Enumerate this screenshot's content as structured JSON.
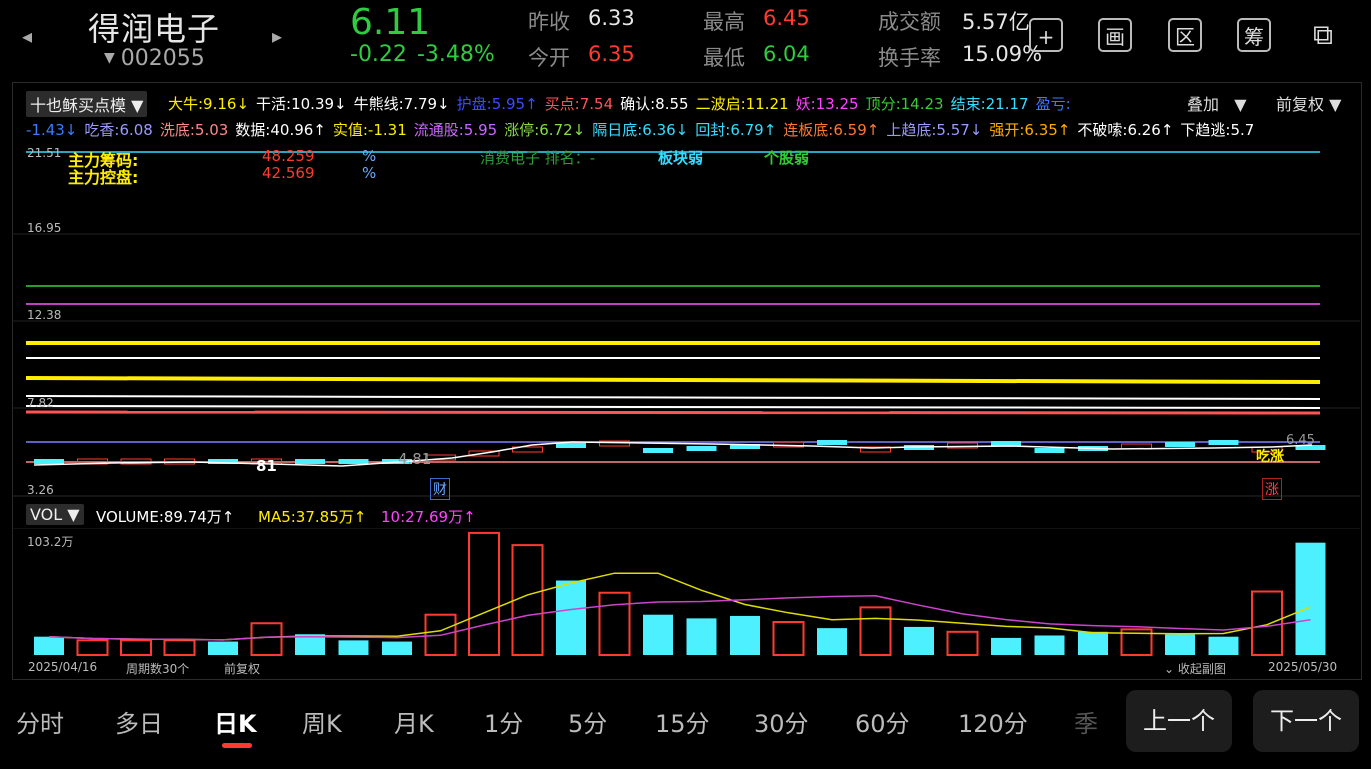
{
  "header": {
    "name": "得润电子",
    "code": "002055",
    "price": "6.11",
    "change": "-0.22",
    "change_pct": "-3.48%",
    "quotes": {
      "prev_close_label": "昨收",
      "prev_close": "6.33",
      "open_label": "今开",
      "open": "6.35",
      "high_label": "最高",
      "high": "6.45",
      "low_label": "最低",
      "low": "6.04",
      "amount_label": "成交额",
      "amount": "5.57亿",
      "turnover_label": "换手率",
      "turnover": "15.09%"
    },
    "toolbar": [
      "+",
      "画",
      "区",
      "筹",
      "⧉"
    ]
  },
  "indicator": {
    "name": "十也稣买点模",
    "overlay": "叠加",
    "adjust": "前复权",
    "row1": [
      {
        "t": "大牛:9.16↓",
        "c": "#ffee00"
      },
      {
        "t": "干活:10.39↓",
        "c": "#ffffff"
      },
      {
        "t": "牛熊线:7.79↓",
        "c": "#ffffff"
      },
      {
        "t": "护盘:5.95↑",
        "c": "#3a4cff"
      },
      {
        "t": "买点:7.54",
        "c": "#ff5555"
      },
      {
        "t": "确认:8.55",
        "c": "#ffffff"
      },
      {
        "t": "二波启:11.21",
        "c": "#ffee00"
      },
      {
        "t": "妖:13.25",
        "c": "#ff44ff"
      },
      {
        "t": "顶分:14.23",
        "c": "#33cc33"
      },
      {
        "t": "结束:21.17",
        "c": "#33ddff"
      },
      {
        "t": "盈亏:",
        "c": "#3a7bff"
      }
    ],
    "row2": [
      {
        "t": "-1.43↓",
        "c": "#3a7bff"
      },
      {
        "t": "吃香:6.08",
        "c": "#9a9aff"
      },
      {
        "t": "洗底:5.03",
        "c": "#ff8888"
      },
      {
        "t": "数据:40.96↑",
        "c": "#ffffff"
      },
      {
        "t": "实值:-1.31",
        "c": "#ffee00"
      },
      {
        "t": "流通股:5.95",
        "c": "#cc66ff"
      },
      {
        "t": "涨停:6.72↓",
        "c": "#88dd44"
      },
      {
        "t": "隔日底:6.36↓",
        "c": "#33ddff"
      },
      {
        "t": "回封:6.79↑",
        "c": "#33ddff"
      },
      {
        "t": "连板底:6.59↑",
        "c": "#ff7733"
      },
      {
        "t": "上趋底:5.57↓",
        "c": "#9a9aff"
      },
      {
        "t": "强开:6.35↑",
        "c": "#ffaa00"
      },
      {
        "t": "不破嗦:6.26↑",
        "c": "#ffffff"
      },
      {
        "t": "下趋逃:5.7",
        "c": "#ffffff"
      }
    ],
    "fund_chips_label": "主力筹码:",
    "fund_chips": "48.259",
    "fund_ctrl_label": "主力控盘:",
    "fund_ctrl": "42.569",
    "pct": "%",
    "sector": "消费电子 排名：-",
    "sector_state": "板块弱",
    "stock_state": "个股弱",
    "marker_81": "81",
    "marker_481": "4.81",
    "tag_cai": "财",
    "tag_zhang": "涨",
    "tag_chizhang": "吃涨",
    "tag_645": "6.45"
  },
  "price_axis": [
    "21.51",
    "16.95",
    "12.38",
    "7.82",
    "3.26"
  ],
  "volume": {
    "label": "VOL",
    "volume": "VOLUME:89.74万↑",
    "ma5": "MA5:37.85万↑",
    "ma10": "10:27.69万↑",
    "max": "103.2万",
    "start_date": "2025/04/16",
    "period": "周期数30个",
    "adjust": "前复权",
    "collapse": "收起副图",
    "end_date": "2025/05/30"
  },
  "chart_data": {
    "type": "bar",
    "title": "",
    "values": [
      15,
      12,
      12,
      12,
      11,
      26,
      17,
      12,
      11,
      33,
      100,
      90,
      61,
      51,
      33,
      30,
      32,
      27,
      22,
      39,
      23,
      19,
      14,
      16,
      19,
      21,
      17,
      15,
      52,
      92
    ],
    "up": [
      false,
      true,
      true,
      true,
      false,
      true,
      false,
      false,
      false,
      true,
      true,
      true,
      false,
      true,
      false,
      false,
      false,
      true,
      false,
      true,
      false,
      true,
      false,
      false,
      false,
      true,
      false,
      false,
      true,
      false
    ],
    "ylim": [
      0,
      103.2
    ]
  },
  "tabs": [
    "分时",
    "多日",
    "日K",
    "周K",
    "月K",
    "1分",
    "5分",
    "15分",
    "30分",
    "60分",
    "120分",
    "季"
  ],
  "active_tab": 2,
  "pager": {
    "prev": "上一个",
    "next": "下一个"
  }
}
